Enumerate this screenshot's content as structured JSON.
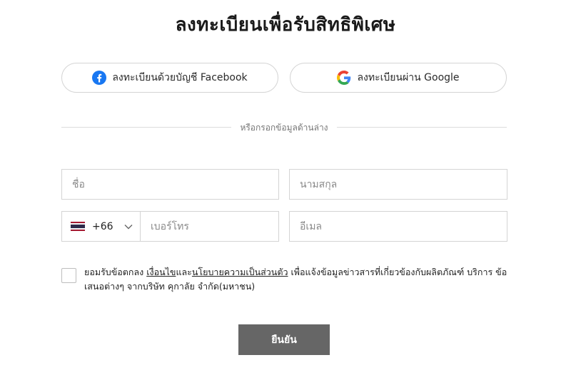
{
  "page": {
    "title": "ลงทะเบียนเพื่อรับสิทธิพิเศษ"
  },
  "social": {
    "facebook_label": "ลงทะเบียนด้วยบัญชี Facebook",
    "google_label": "ลงทะเบียนผ่าน Google",
    "facebook_icon": "facebook-icon",
    "google_icon": "google-icon"
  },
  "divider": {
    "text": "หรือกรอกข้อมูลด้านล่าง"
  },
  "form": {
    "first_name_placeholder": "ชื่อ",
    "last_name_placeholder": "นามสกุล",
    "country_code": "+66",
    "country_flag": "thailand-flag-icon",
    "phone_placeholder": "เบอร์โทร",
    "email_placeholder": "อีเมล"
  },
  "consent": {
    "checked": false,
    "prefix": "ยอมรับข้อตกลง ",
    "terms_link": "เงื่อนไข",
    "and": "และ",
    "privacy_link": "นโยบายความเป็นส่วนตัว",
    "suffix": " เพื่อแจ้งข้อมูลข่าวสารที่เกี่ยวข้องกับผลิตภัณฑ์ บริการ ข้อเสนอต่างๆ จากบริษัท คุกาลัย จำกัด(มหาชน)"
  },
  "submit": {
    "label": "ยืนยัน"
  },
  "colors": {
    "submit_bg": "#666666",
    "border": "#d4d4d4",
    "facebook_blue": "#1877F2"
  }
}
